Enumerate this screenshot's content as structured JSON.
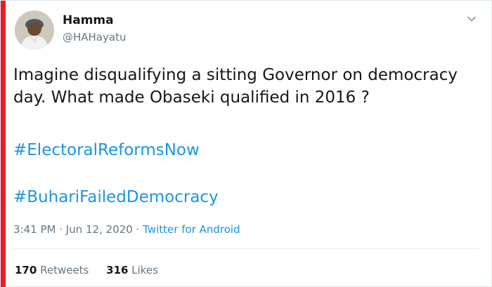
{
  "tweet": {
    "author_name": "Hamma",
    "author_handle": "@HAHayatu",
    "text": "Imagine disqualifying a sitting Governor on democracy day. What made Obaseki qualified in 2016 ?",
    "hashtags": [
      "#ElectoralReformsNow",
      "#BuhariFailedDemocracy"
    ],
    "time": "3:41 PM",
    "separator": "·",
    "date": "Jun 12, 2020",
    "source": "Twitter for Android",
    "retweets_count": "170",
    "retweets_label": "Retweets",
    "likes_count": "316",
    "likes_label": "Likes"
  },
  "icons": {
    "caret": "chevron-down-icon",
    "avatar": "user-avatar"
  },
  "colors": {
    "accent": "#1b95e0",
    "muted": "#657786",
    "text": "#14171a",
    "left_bar": "#ec1c24"
  }
}
